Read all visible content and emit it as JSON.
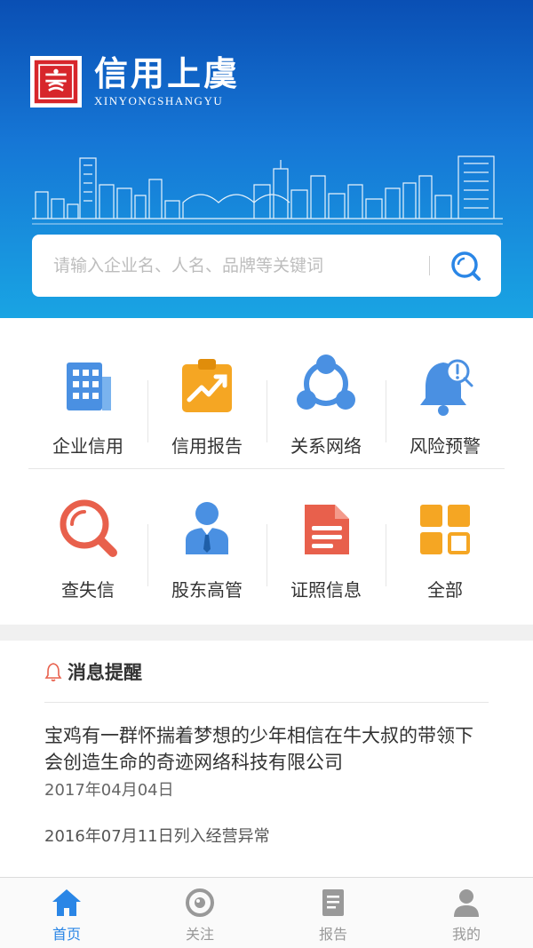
{
  "header": {
    "app_title": "信用上虞",
    "app_subtitle": "XINYONGSHANGYU"
  },
  "search": {
    "placeholder": "请输入企业名、人名、品牌等关键词",
    "value": ""
  },
  "features": [
    {
      "label": "企业信用",
      "icon": "building-icon",
      "color": "#4a90e2"
    },
    {
      "label": "信用报告",
      "icon": "clipboard-chart-icon",
      "color": "#f5a623"
    },
    {
      "label": "关系网络",
      "icon": "network-icon",
      "color": "#4a90e2"
    },
    {
      "label": "风险预警",
      "icon": "alert-bell-icon",
      "color": "#4a90e2"
    },
    {
      "label": "查失信",
      "icon": "magnifier-icon",
      "color": "#e8604c"
    },
    {
      "label": "股东高管",
      "icon": "person-tie-icon",
      "color": "#4a90e2"
    },
    {
      "label": "证照信息",
      "icon": "document-icon",
      "color": "#e8604c"
    },
    {
      "label": "全部",
      "icon": "grid-icon",
      "color": "#f5a623"
    }
  ],
  "messages": {
    "title": "消息提醒",
    "items": [
      {
        "title": "宝鸡有一群怀揣着梦想的少年相信在牛大叔的带领下会创造生命的奇迹网络科技有限公司",
        "date": "2017年04月04日"
      },
      {
        "title": "2016年07月11日列入经营异常"
      }
    ]
  },
  "tabbar": [
    {
      "label": "首页",
      "icon": "home-icon",
      "active": true
    },
    {
      "label": "关注",
      "icon": "eye-icon",
      "active": false
    },
    {
      "label": "报告",
      "icon": "report-icon",
      "active": false
    },
    {
      "label": "我的",
      "icon": "user-icon",
      "active": false
    }
  ],
  "colors": {
    "primary": "#2a86e6",
    "hero_top": "#0a4fb4",
    "hero_bottom": "#19a4e3"
  }
}
